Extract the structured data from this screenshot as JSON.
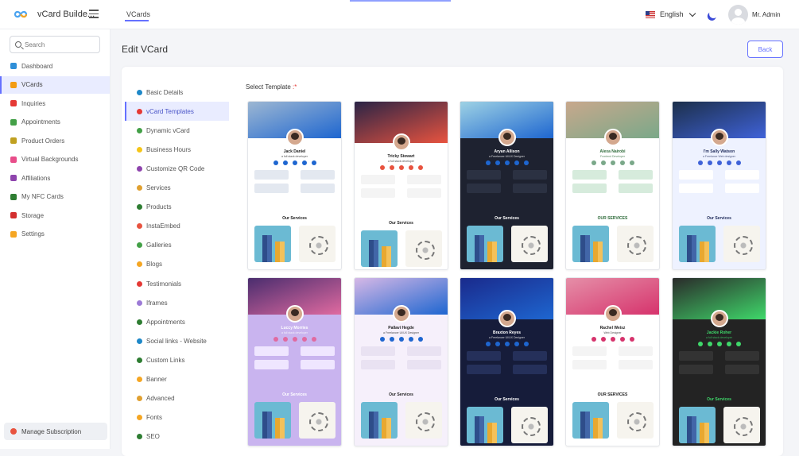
{
  "app": {
    "brand": "vCard Builde...",
    "top_tab": "VCards",
    "language": "English",
    "user_name": "Mr. Admin"
  },
  "search": {
    "placeholder": "Search"
  },
  "sidebar": {
    "items": [
      {
        "label": "Dashboard",
        "icon": "dashboard-icon",
        "color": "#2f8fd8"
      },
      {
        "label": "VCards",
        "icon": "vcard-icon",
        "color": "#f39c12",
        "active": true
      },
      {
        "label": "Inquiries",
        "icon": "inquiry-icon",
        "color": "#e53935"
      },
      {
        "label": "Appointments",
        "icon": "calendar-icon",
        "color": "#43a047"
      },
      {
        "label": "Product Orders",
        "icon": "orders-icon",
        "color": "#c0a020"
      },
      {
        "label": "Virtual Backgrounds",
        "icon": "background-icon",
        "color": "#e84d8a"
      },
      {
        "label": "Affiliations",
        "icon": "affiliation-icon",
        "color": "#8e44ad"
      },
      {
        "label": "My NFC Cards",
        "icon": "nfc-card-icon",
        "color": "#2e7d32"
      },
      {
        "label": "Storage",
        "icon": "storage-icon",
        "color": "#d32f2f"
      },
      {
        "label": "Settings",
        "icon": "settings-icon",
        "color": "#f5a623"
      }
    ],
    "manage_subscription": "Manage Subscription"
  },
  "page": {
    "title": "Edit VCard",
    "back_label": "Back",
    "select_template_label": "Select Template",
    "required_mark": ":*"
  },
  "sub_nav": [
    {
      "label": "Basic Details",
      "icon": "info-icon",
      "color": "#1e88c8"
    },
    {
      "label": "vCard Templates",
      "icon": "template-icon",
      "color": "#e53935",
      "active": true
    },
    {
      "label": "Dynamic vCard",
      "icon": "dynamic-icon",
      "color": "#43a047"
    },
    {
      "label": "Business Hours",
      "icon": "clock-icon",
      "color": "#f5c518"
    },
    {
      "label": "Customize QR Code",
      "icon": "qr-code-icon",
      "color": "#8e44ad"
    },
    {
      "label": "Services",
      "icon": "wrench-icon",
      "color": "#e0a030"
    },
    {
      "label": "Products",
      "icon": "product-icon",
      "color": "#2e7d32"
    },
    {
      "label": "InstaEmbed",
      "icon": "instagram-icon",
      "color": "#e8533f"
    },
    {
      "label": "Galleries",
      "icon": "gallery-icon",
      "color": "#43a047"
    },
    {
      "label": "Blogs",
      "icon": "blog-icon",
      "color": "#f5a623"
    },
    {
      "label": "Testimonials",
      "icon": "testimonial-icon",
      "color": "#e53935"
    },
    {
      "label": "Iframes",
      "icon": "iframe-icon",
      "color": "#9c7ad6"
    },
    {
      "label": "Appointments",
      "icon": "calendar-icon",
      "color": "#2e7d32"
    },
    {
      "label": "Social links - Website",
      "icon": "globe-icon",
      "color": "#1e88c8"
    },
    {
      "label": "Custom Links",
      "icon": "link-icon",
      "color": "#2e7d32"
    },
    {
      "label": "Banner",
      "icon": "banner-icon",
      "color": "#f5a623"
    },
    {
      "label": "Advanced",
      "icon": "advanced-icon",
      "color": "#e0a030"
    },
    {
      "label": "Fonts",
      "icon": "font-icon",
      "color": "#f5a623"
    },
    {
      "label": "SEO",
      "icon": "seo-icon",
      "color": "#2e7d32"
    }
  ],
  "templates": [
    {
      "name": "Jack Daniel",
      "role": "a full stack developer",
      "services": "Our Services",
      "hero": "#9db7d2",
      "body": "#ffffff",
      "text": "#222222",
      "accent": "#1e66d0",
      "panel": "#e3e8f0"
    },
    {
      "name": "Tricky Stewart",
      "role": "a full stack developer",
      "services": "Our Services",
      "hero": "#2a2446",
      "body": "#ffffff",
      "text": "#222222",
      "accent": "#e8533f",
      "panel": "#f4f4f4"
    },
    {
      "name": "Aryan Allison",
      "role": "a Freelancer UI/UX Designer",
      "services": "Our Services",
      "hero": "#9ed2e4",
      "body": "#1e2230",
      "text": "#ffffff",
      "accent": "#1e66d0",
      "panel": "#2b3142"
    },
    {
      "name": "Alexa Nairobi",
      "role": "Frontend Developer",
      "services": "OUR SERVICES",
      "hero": "#c8a88c",
      "body": "#ffffff",
      "text": "#2e6b3a",
      "accent": "#7aa889",
      "panel": "#d6ebdc"
    },
    {
      "name": "I'm Sally Watson",
      "role": "a Freelance Web designer",
      "services": "Our Services",
      "hero": "#1c2f4a",
      "body": "#eef2ff",
      "text": "#1e2a5a",
      "accent": "#3f62d8",
      "panel": "#ffffff"
    },
    {
      "name": "Luccy Morries",
      "role": "a full stack developer",
      "services": "Our Services",
      "hero": "#4a2d6e",
      "body": "#c9b4ef",
      "text": "#ffffff",
      "accent": "#e06aa0",
      "panel": "#efe6ff"
    },
    {
      "name": "Pallavi Hegde",
      "role": "a Freelancer UI/UX Designer",
      "services": "Our Services",
      "hero": "#d6b8e6",
      "body": "#f6f0fb",
      "text": "#222222",
      "accent": "#1e66d0",
      "panel": "#e9e2f2"
    },
    {
      "name": "Braxton Reyes",
      "role": "a Freelancer UI/UX Designer",
      "services": "Our Services",
      "hero": "#1a2a8c",
      "body": "#161c3a",
      "text": "#ffffff",
      "accent": "#1e66d0",
      "panel": "#25305a"
    },
    {
      "name": "Rachel Weisz",
      "role": "Web Designer",
      "services": "OUR SERVICES",
      "hero": "#e58fa8",
      "body": "#ffffff",
      "text": "#222222",
      "accent": "#d6336c",
      "panel": "#f4f4f4"
    },
    {
      "name": "Jackie Roher",
      "role": "a full stack developer",
      "services": "Our Services",
      "hero": "#2a2a2a",
      "body": "#232323",
      "text": "#3fd86a",
      "accent": "#3fd86a",
      "panel": "#333333"
    }
  ]
}
